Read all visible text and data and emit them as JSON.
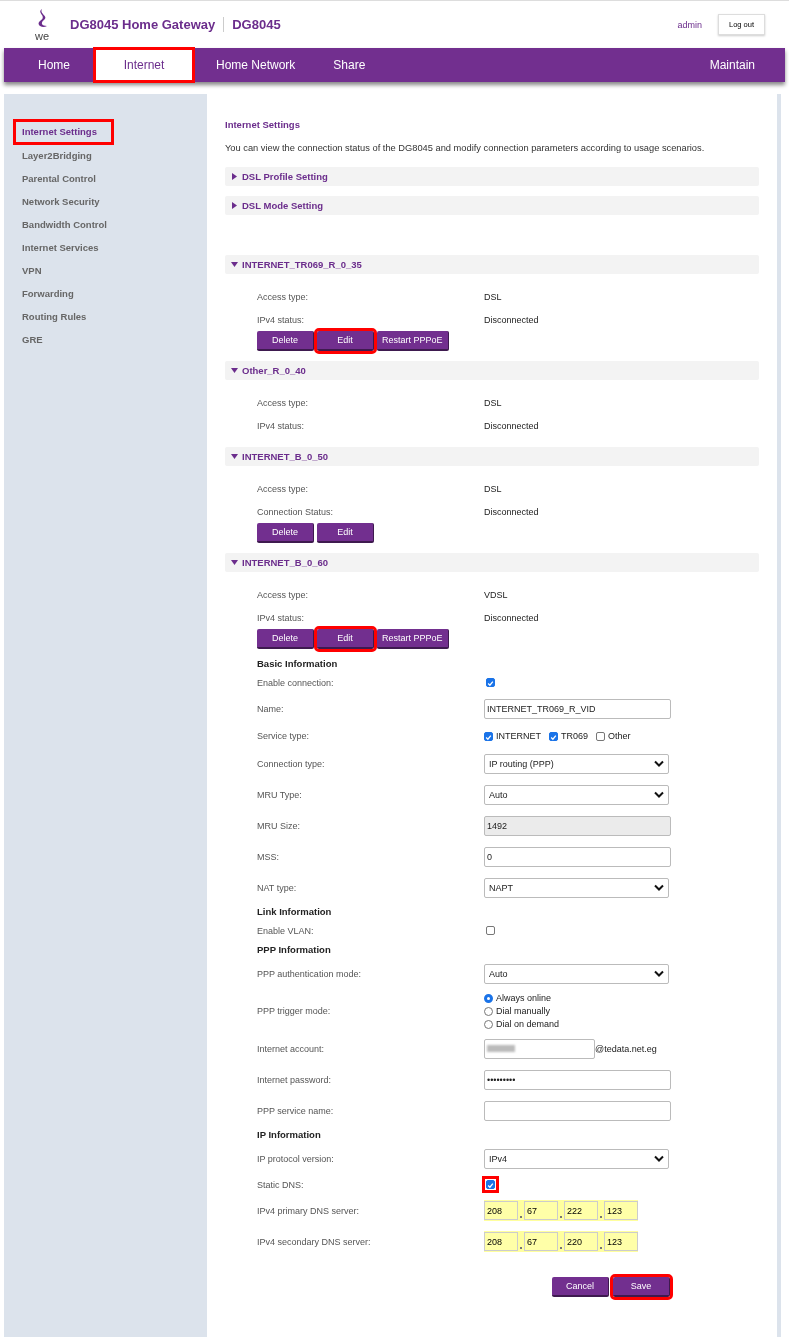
{
  "header": {
    "logo_text": "we",
    "title": "DG8045 Home Gateway",
    "model": "DG8045",
    "user": "admin",
    "logout": "Log out"
  },
  "nav": [
    {
      "label": "Home",
      "selected": false,
      "highlighted": false
    },
    {
      "label": "Internet",
      "selected": true,
      "highlighted": true
    },
    {
      "label": "Home Network",
      "selected": false,
      "highlighted": false
    },
    {
      "label": "Share",
      "selected": false,
      "highlighted": false
    },
    {
      "label": "Maintain",
      "selected": false,
      "highlighted": false
    }
  ],
  "sidebar": {
    "items": [
      {
        "label": "Internet Settings",
        "selected": true,
        "highlighted": true
      },
      {
        "label": "Layer2Bridging",
        "selected": false,
        "highlighted": false
      },
      {
        "label": "Parental Control",
        "selected": false,
        "highlighted": false
      },
      {
        "label": "Network Security",
        "selected": false,
        "highlighted": false
      },
      {
        "label": "Bandwidth Control",
        "selected": false,
        "highlighted": false
      },
      {
        "label": "Internet Services",
        "selected": false,
        "highlighted": false
      },
      {
        "label": "VPN",
        "selected": false,
        "highlighted": false
      },
      {
        "label": "Forwarding",
        "selected": false,
        "highlighted": false
      },
      {
        "label": "Routing Rules",
        "selected": false,
        "highlighted": false
      },
      {
        "label": "GRE",
        "selected": false,
        "highlighted": false
      }
    ]
  },
  "content": {
    "title": "Internet Settings",
    "description": "You can view the connection status of the DG8045 and modify connection parameters according to usage scenarios.",
    "sections": [
      {
        "title": "DSL Profile Setting",
        "expanded": false
      },
      {
        "title": "DSL Mode Setting",
        "expanded": false
      },
      {
        "title": "INTERNET_TR069_R_0_35",
        "expanded": true,
        "rows": [
          {
            "label": "Access type:",
            "value": "DSL"
          },
          {
            "label": "IPv4 status:",
            "value": "Disconnected"
          }
        ],
        "buttons": [
          {
            "label": "Delete",
            "highlighted": false
          },
          {
            "label": "Edit",
            "highlighted": true
          },
          {
            "label": "Restart PPPoE",
            "highlighted": false
          }
        ]
      },
      {
        "title": "Other_R_0_40",
        "expanded": true,
        "rows": [
          {
            "label": "Access type:",
            "value": "DSL"
          },
          {
            "label": "IPv4 status:",
            "value": "Disconnected"
          }
        ]
      },
      {
        "title": "INTERNET_B_0_50",
        "expanded": true,
        "rows": [
          {
            "label": "Access type:",
            "value": "DSL"
          },
          {
            "label": "Connection Status:",
            "value": "Disconnected"
          }
        ],
        "buttons": [
          {
            "label": "Delete",
            "highlighted": false
          },
          {
            "label": "Edit",
            "highlighted": false
          }
        ]
      },
      {
        "title": "INTERNET_B_0_60",
        "expanded": true,
        "rows": [
          {
            "label": "Access type:",
            "value": "VDSL"
          },
          {
            "label": "IPv4 status:",
            "value": "Disconnected"
          }
        ],
        "buttons": [
          {
            "label": "Delete",
            "highlighted": false
          },
          {
            "label": "Edit",
            "highlighted": true
          },
          {
            "label": "Restart PPPoE",
            "highlighted": false
          }
        ]
      }
    ],
    "form": {
      "rows": [
        {
          "kind": "heading",
          "label": "Basic Information"
        },
        {
          "kind": "checkbox",
          "label": "Enable connection:",
          "checked": true,
          "highlighted": false
        },
        {
          "kind": "input",
          "label": "Name:",
          "value": "INTERNET_TR069_R_VID",
          "disabled": false
        },
        {
          "kind": "checks",
          "label": "Service type:",
          "options": [
            {
              "label": "INTERNET",
              "checked": true
            },
            {
              "label": "TR069",
              "checked": true
            },
            {
              "label": "Other",
              "checked": false
            }
          ]
        },
        {
          "kind": "select",
          "label": "Connection type:",
          "value": "IP routing (PPP)"
        },
        {
          "kind": "select",
          "label": "MRU Type:",
          "value": "Auto"
        },
        {
          "kind": "input",
          "label": "MRU Size:",
          "value": "1492",
          "disabled": true
        },
        {
          "kind": "input",
          "label": "MSS:",
          "value": "0",
          "disabled": false
        },
        {
          "kind": "select",
          "label": "NAT type:",
          "value": "NAPT"
        },
        {
          "kind": "heading",
          "label": "Link Information"
        },
        {
          "kind": "checkbox",
          "label": "Enable VLAN:",
          "checked": false,
          "highlighted": false
        },
        {
          "kind": "heading",
          "label": "PPP Information"
        },
        {
          "kind": "select",
          "label": "PPP authentication mode:",
          "value": "Auto"
        },
        {
          "kind": "radios",
          "label": "PPP trigger mode:",
          "options": [
            {
              "label": "Always online",
              "selected": true
            },
            {
              "label": "Dial manually",
              "selected": false
            },
            {
              "label": "Dial on demand",
              "selected": false
            }
          ]
        },
        {
          "kind": "account",
          "label": "Internet account:",
          "suffix": "@tedata.net.eg"
        },
        {
          "kind": "input",
          "label": "Internet password:",
          "value": "•••••••••",
          "disabled": false
        },
        {
          "kind": "input",
          "label": "PPP service name:",
          "disabled": false
        },
        {
          "kind": "heading",
          "label": "IP Information"
        },
        {
          "kind": "select",
          "label": "IP protocol version:",
          "value": "IPv4"
        },
        {
          "kind": "checkbox",
          "label": "Static DNS:",
          "checked": true,
          "highlighted": true
        },
        {
          "kind": "ip",
          "label": "IPv4 primary DNS server:",
          "octets": [
            "208",
            "67",
            "222",
            "123"
          ]
        },
        {
          "kind": "ip",
          "label": "IPv4 secondary DNS server:",
          "octets": [
            "208",
            "67",
            "220",
            "123"
          ]
        }
      ],
      "buttons": [
        {
          "label": "Cancel",
          "highlighted": false
        },
        {
          "label": "Save",
          "highlighted": true
        }
      ]
    }
  }
}
